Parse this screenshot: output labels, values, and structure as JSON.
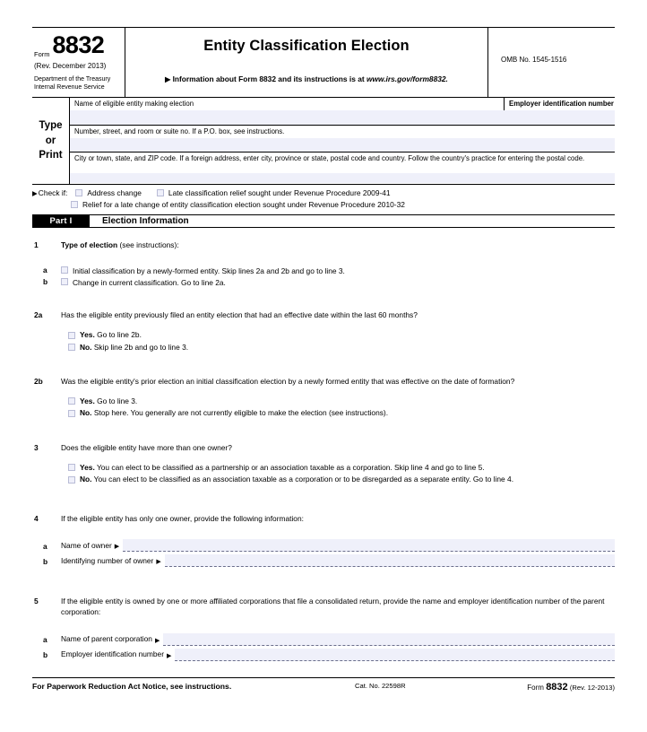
{
  "header": {
    "form_word": "Form",
    "form_number": "8832",
    "revision": "(Rev. December 2013)",
    "department": "Department of the Treasury\nInternal Revenue Service",
    "department_line1": "Department of the Treasury",
    "department_line2": "Internal Revenue Service",
    "title": "Entity Classification Election",
    "info_arrow": "▶",
    "info_prefix": "Information about Form 8832 and its instructions is at ",
    "info_url": "www.irs.gov/form8832.",
    "omb": "OMB No. 1545-1516"
  },
  "type_or_print": {
    "label_line1": "Type",
    "label_line2": "or",
    "label_line3": "Print",
    "row1_caption": "Name of eligible entity making election",
    "ein_caption": "Employer identification number",
    "row2_caption": "Number, street, and room or suite no. If a P.O. box, see instructions.",
    "row3_caption": "City or town, state, and ZIP code. If a foreign address, enter city, province or state, postal code and country. Follow the country's practice for entering the postal code.",
    "field_fill_color": "#eff0fa"
  },
  "check_if": {
    "arrow": "▶",
    "label": "Check if:",
    "option1": "Address change",
    "option2": "Late classification relief sought under Revenue Procedure 2009-41",
    "option3": "Relief for a late change of entity classification election sought under Revenue Procedure 2010-32"
  },
  "part": {
    "tag": "Part I",
    "title": "Election Information"
  },
  "lines": {
    "l1": {
      "num": "1",
      "lead": "Type of election",
      "rest": " (see instructions):",
      "a_num": "a",
      "a_text": "Initial classification by a newly-formed entity. Skip lines 2a and 2b and go to line 3.",
      "b_num": "b",
      "b_text": "Change in current classification. Go to line 2a."
    },
    "l2a": {
      "num": "2a",
      "question": "Has the eligible entity previously filed an entity election that had an effective date within the last 60 months?",
      "yes_lead": "Yes.",
      "yes_text": " Go to line 2b.",
      "no_lead": "No.",
      "no_text": " Skip line 2b and go to line 3."
    },
    "l2b": {
      "num": "2b",
      "question": "Was the eligible entity's prior election an initial classification election by a newly formed entity that was effective on the date of formation?",
      "yes_lead": "Yes.",
      "yes_text": " Go to line 3.",
      "no_lead": "No.",
      "no_text": " Stop here. You generally are not currently eligible to make the election (see instructions)."
    },
    "l3": {
      "num": "3",
      "question": "Does the eligible entity have more than one owner?",
      "yes_lead": "Yes.",
      "yes_text": " You can elect to be classified as a partnership or an association taxable as a corporation. Skip line 4 and go to line 5.",
      "no_lead": "No.",
      "no_text": " You can elect to be classified as an association taxable as a corporation or to be disregarded as a separate entity. Go to  line 4."
    },
    "l4": {
      "num": "4",
      "question": "If the eligible entity has only one owner, provide the following information:",
      "a_num": "a",
      "a_label": "Name of owner",
      "a_value": "",
      "b_num": "b",
      "b_label": "Identifying number of owner",
      "b_value": "",
      "arrow": "▶"
    },
    "l5": {
      "num": "5",
      "question": "If the eligible entity is owned by one or more affiliated corporations that file a consolidated return, provide the name and employer identification number of the parent corporation:",
      "a_num": "a",
      "a_label": "Name of parent corporation",
      "a_value": "",
      "b_num": "b",
      "b_label": "Employer identification number",
      "b_value": "",
      "arrow": "▶"
    }
  },
  "footer": {
    "notice": "For Paperwork Reduction Act Notice, see instructions.",
    "cat_no": "Cat. No. 22598R",
    "form_word": "Form",
    "form_number": "8832",
    "revision": "(Rev. 12-2013)"
  }
}
